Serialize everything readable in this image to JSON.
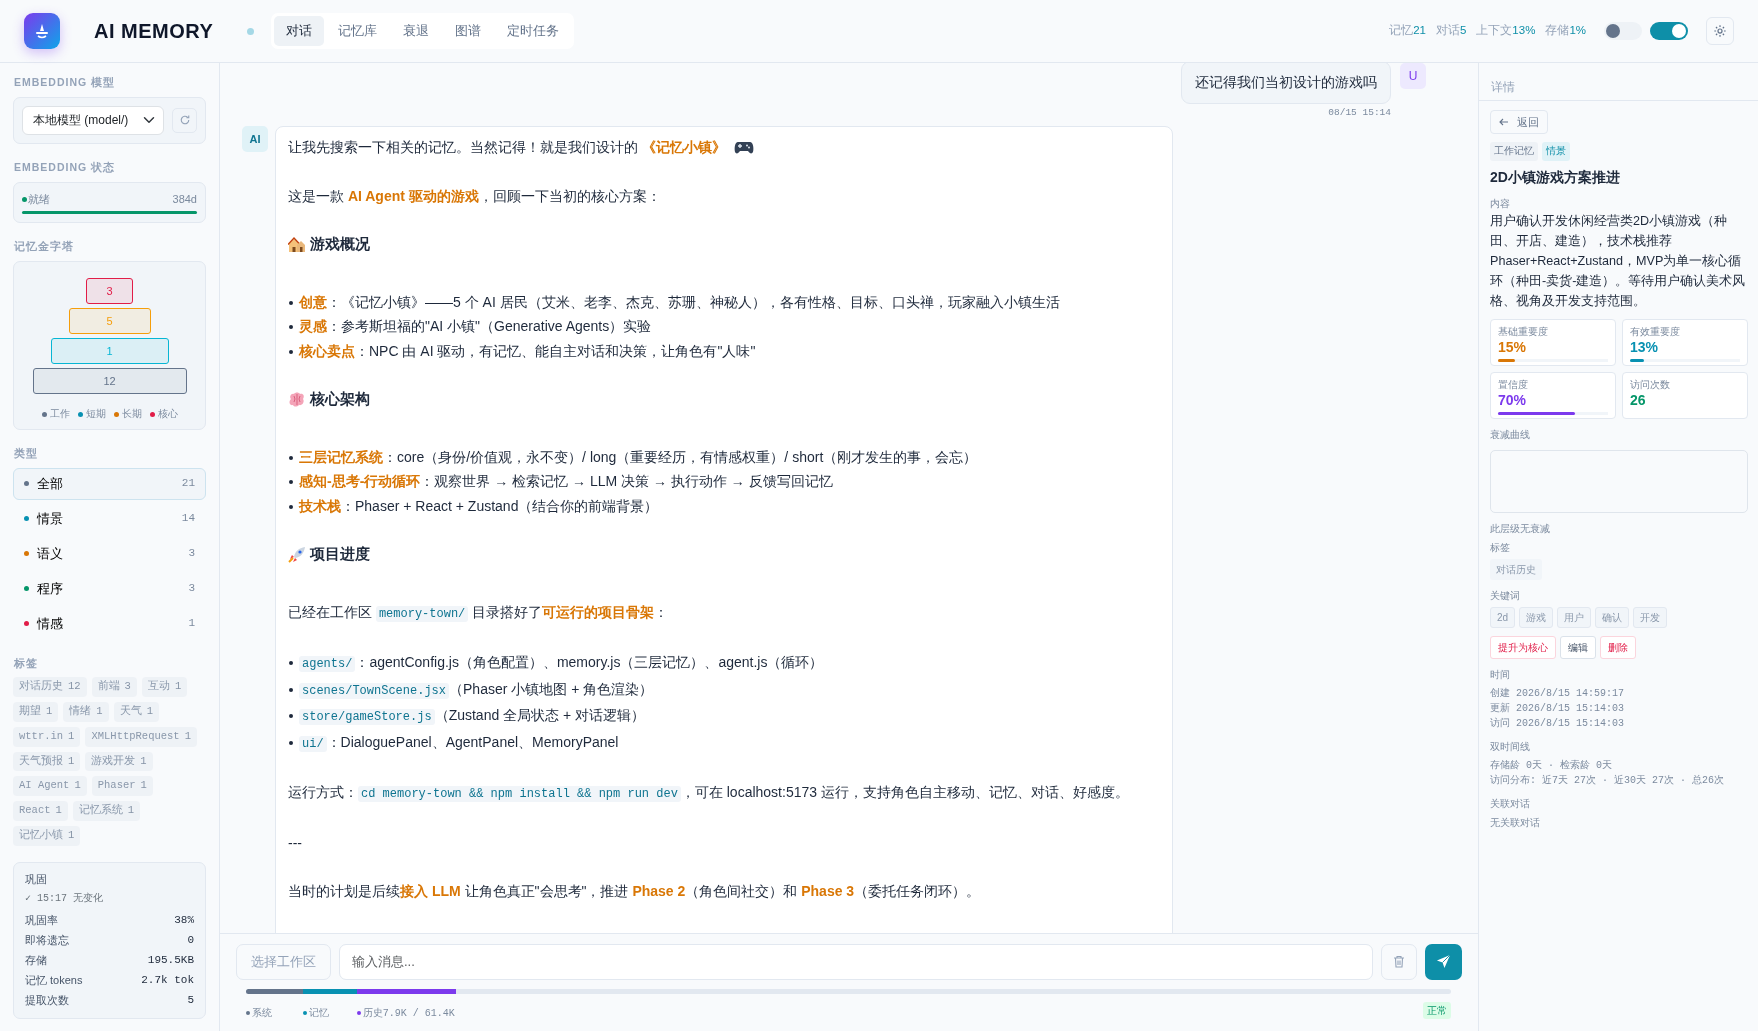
{
  "app": {
    "title": "AI MEMORY"
  },
  "nav_tabs": [
    {
      "label": "对话",
      "selected": true
    },
    {
      "label": "记忆库",
      "selected": false
    },
    {
      "label": "衰退",
      "selected": false
    },
    {
      "label": "图谱",
      "selected": false
    },
    {
      "label": "定时任务",
      "selected": false
    }
  ],
  "stats": [
    {
      "label": "记忆",
      "value": "21"
    },
    {
      "label": "对话",
      "value": "5"
    },
    {
      "label": "上下文",
      "value": "13%"
    },
    {
      "label": "存储",
      "value": "1%"
    }
  ],
  "toggles": [
    {
      "on": false
    },
    {
      "on": true
    }
  ],
  "sidebar": {
    "embedding_model": {
      "label": "EMBEDDING 模型",
      "value": "本地模型 (model/)"
    },
    "embedding_status": {
      "label": "EMBEDDING 状态",
      "status": "就绪",
      "dimension": "384d",
      "level": 1
    },
    "pyramid": {
      "label": "记忆金字塔",
      "levels": [
        {
          "count": "3",
          "color": "#e11d48"
        },
        {
          "count": "5",
          "color": "#f59e0b"
        },
        {
          "count": "1",
          "color": "#06b6d4"
        },
        {
          "count": "12",
          "color": "#64748b"
        }
      ],
      "legend": [
        {
          "label": "工作",
          "color": "#64748b"
        },
        {
          "label": "短期",
          "color": "#0891b2"
        },
        {
          "label": "长期",
          "color": "#d97706"
        },
        {
          "label": "核心",
          "color": "#e11d48"
        }
      ]
    },
    "types": {
      "label": "类型",
      "items": [
        {
          "label": "全部",
          "count": "21",
          "color": "#64748b",
          "selected": true
        },
        {
          "label": "情景",
          "count": "14",
          "color": "#0891b2",
          "selected": false
        },
        {
          "label": "语义",
          "count": "3",
          "color": "#d97706",
          "selected": false
        },
        {
          "label": "程序",
          "count": "3",
          "color": "#059669",
          "selected": false
        },
        {
          "label": "情感",
          "count": "1",
          "color": "#e11d48",
          "selected": false
        }
      ]
    },
    "tags": {
      "label": "标签",
      "items": [
        {
          "label": "对话历史",
          "count": "12"
        },
        {
          "label": "前端",
          "count": "3"
        },
        {
          "label": "互动",
          "count": "1"
        },
        {
          "label": "期望",
          "count": "1"
        },
        {
          "label": "情绪",
          "count": "1"
        },
        {
          "label": "天气",
          "count": "1"
        },
        {
          "label": "wttr.in",
          "count": "1"
        },
        {
          "label": "XMLHttpRequest",
          "count": "1"
        },
        {
          "label": "天气预报",
          "count": "1"
        },
        {
          "label": "游戏开发",
          "count": "1"
        },
        {
          "label": "AI Agent",
          "count": "1"
        },
        {
          "label": "Phaser",
          "count": "1"
        },
        {
          "label": "React",
          "count": "1"
        },
        {
          "label": "记忆系统",
          "count": "1"
        },
        {
          "label": "记忆小镇",
          "count": "1"
        }
      ]
    },
    "consolidation": {
      "title": "巩固",
      "status": "✓ 15:17 无变化",
      "rows": [
        {
          "label": "巩固率",
          "value": "38%"
        },
        {
          "label": "即将遗忘",
          "value": "0"
        },
        {
          "label": "存储",
          "value": "195.5KB"
        },
        {
          "label": "记忆 tokens",
          "value": "2.7k tok"
        },
        {
          "label": "提取次数",
          "value": "5"
        }
      ]
    }
  },
  "chat": {
    "user_message": {
      "avatar": "U",
      "text": "还记得我们当初设计的游戏吗",
      "time": "08/15 15:14"
    },
    "ai_message": {
      "avatar": "AI",
      "blocks": [
        {
          "kind": "p",
          "segments": [
            {
              "text": "让我先搜索一下相关的记忆。当然记得！就是我们设计的 ",
              "kind": "plain"
            },
            {
              "text": "《记忆小镇》",
              "kind": "accent"
            }
          ]
        },
        {
          "kind": "p",
          "segments": [
            {
              "text": "这是一款 ",
              "kind": "plain"
            },
            {
              "text": "AI Agent 驱动的游戏",
              "kind": "accent"
            },
            {
              "text": "，回顾一下当初的核心方案：",
              "kind": "plain"
            }
          ]
        },
        {
          "kind": "h",
          "segments": [
            {
              "text": "游戏概况",
              "kind": "plain"
            }
          ]
        },
        {
          "kind": "li",
          "segments": [
            {
              "text": "创意",
              "kind": "accent"
            },
            {
              "text": "：《记忆小镇》——5 个 AI 居民（艾米、老李、杰克、苏珊、神秘人），各有性格、目标、口头禅，玩家融入小镇生活",
              "kind": "plain"
            }
          ]
        },
        {
          "kind": "li",
          "segments": [
            {
              "text": "灵感",
              "kind": "accent"
            },
            {
              "text": "：参考斯坦福的\"AI 小镇\"（Generative Agents）实验",
              "kind": "plain"
            }
          ]
        },
        {
          "kind": "li",
          "segments": [
            {
              "text": "核心卖点",
              "kind": "accent"
            },
            {
              "text": "：NPC 由 AI 驱动，有记忆、能自主对话和决策，让角色有\"人味\"",
              "kind": "plain"
            }
          ]
        },
        {
          "kind": "h",
          "segments": [
            {
              "text": "核心架构",
              "kind": "plain"
            }
          ]
        },
        {
          "kind": "li",
          "segments": [
            {
              "text": "三层记忆系统",
              "kind": "accent"
            },
            {
              "text": "：core（身份/价值观，永不变）/ long（重要经历，有情感权重）/ short（刚才发生的事，会忘）",
              "kind": "plain"
            }
          ]
        },
        {
          "kind": "li",
          "segments": [
            {
              "text": "感知-思考-行动循环",
              "kind": "accent"
            },
            {
              "text": "：观察世界 → 检索记忆 → LLM 决策 → 执行动作 → 反馈写回记忆",
              "kind": "plain"
            }
          ]
        },
        {
          "kind": "li",
          "segments": [
            {
              "text": "技术栈",
              "kind": "accent"
            },
            {
              "text": "：Phaser + React + Zustand（结合你的前端背景）",
              "kind": "plain"
            }
          ]
        },
        {
          "kind": "h",
          "segments": [
            {
              "text": "项目进度",
              "kind": "plain"
            }
          ]
        },
        {
          "kind": "p",
          "segments": [
            {
              "text": "已经在工作区 ",
              "kind": "plain"
            },
            {
              "text": "memory-town/",
              "kind": "code"
            },
            {
              "text": " 目录搭好了",
              "kind": "plain"
            },
            {
              "text": "可运行的项目骨架",
              "kind": "accent"
            },
            {
              "text": "：",
              "kind": "plain"
            }
          ]
        },
        {
          "kind": "li",
          "segments": [
            {
              "text": "agents/",
              "kind": "code"
            },
            {
              "text": "：agentConfig.js（角色配置）、memory.js（三层记忆）、agent.js（循环）",
              "kind": "plain"
            }
          ]
        },
        {
          "kind": "li",
          "segments": [
            {
              "text": "scenes/TownScene.jsx",
              "kind": "code"
            },
            {
              "text": "（Phaser 小镇地图 + 角色渲染）",
              "kind": "plain"
            }
          ]
        },
        {
          "kind": "li",
          "segments": [
            {
              "text": "store/gameStore.js",
              "kind": "code"
            },
            {
              "text": "（Zustand 全局状态 + 对话逻辑）",
              "kind": "plain"
            }
          ]
        },
        {
          "kind": "li",
          "segments": [
            {
              "text": "ui/",
              "kind": "code"
            },
            {
              "text": "：DialoguePanel、AgentPanel、MemoryPanel",
              "kind": "plain"
            }
          ]
        },
        {
          "kind": "p",
          "segments": [
            {
              "text": "运行方式：",
              "kind": "plain"
            },
            {
              "text": "cd memory-town && npm install && npm run dev",
              "kind": "code"
            },
            {
              "text": "，可在 localhost:5173 运行，支持角色自主移动、记忆、对话、好感度。",
              "kind": "plain"
            }
          ]
        },
        {
          "kind": "p",
          "segments": [
            {
              "text": "---",
              "kind": "plain"
            }
          ]
        },
        {
          "kind": "p",
          "segments": [
            {
              "text": "当时的计划是后续",
              "kind": "plain"
            },
            {
              "text": "接入 LLM",
              "kind": "accent"
            },
            {
              "text": " 让角色真正\"会思考\"，推进 ",
              "kind": "plain"
            },
            {
              "text": "Phase 2",
              "kind": "accent"
            },
            {
              "text": "（角色间社交）和 ",
              "kind": "plain"
            },
            {
              "text": "Phase 3",
              "kind": "accent"
            },
            {
              "text": "（委托任务闭环）。",
              "kind": "plain"
            }
          ]
        }
      ]
    }
  },
  "composer": {
    "workspace_button": "选择工作区",
    "placeholder": "输入消息...",
    "context_segments": [
      {
        "label": "系统",
        "level": 0.047,
        "color": "#64748b"
      },
      {
        "label": "记忆",
        "level": 0.045,
        "color": "#0891b2"
      },
      {
        "label": "历史7.9K / 61.4K",
        "level": 0.082,
        "color": "#7c3aed"
      }
    ],
    "status": "正常"
  },
  "detail": {
    "header": "详情",
    "back": "返回",
    "badges": [
      {
        "label": "工作记忆",
        "kind": "tier"
      },
      {
        "label": "情景",
        "kind": "type"
      }
    ],
    "title": "2D小镇游戏方案推进",
    "content_label": "内容",
    "content": "用户确认开发休闲经营类2D小镇游戏（种田、开店、建造），技术栈推荐Phaser+React+Zustand，MVP为单一核心循环（种田-卖货-建造）。等待用户确认美术风格、视角及开发支持范围。",
    "metrics": [
      {
        "label": "基础重要度",
        "value": "15%",
        "level": 0.15,
        "color": "#d97706"
      },
      {
        "label": "有效重要度",
        "value": "13%",
        "level": 0.13,
        "color": "#0891b2"
      },
      {
        "label": "置信度",
        "value": "70%",
        "level": 0.7,
        "color": "#7c3aed"
      },
      {
        "label": "访问次数",
        "value": "26",
        "color": "#059669"
      }
    ],
    "decay_label": "衰减曲线",
    "decay_note": "此层级无衰减",
    "tags_label": "标签",
    "tags": [
      "对话历史"
    ],
    "keywords_label": "关键词",
    "keywords": [
      "2d",
      "游戏",
      "用户",
      "确认",
      "开发"
    ],
    "actions": [
      {
        "label": "提升为核心",
        "kind": "danger"
      },
      {
        "label": "编辑",
        "kind": "default"
      },
      {
        "label": "删除",
        "kind": "danger"
      }
    ],
    "time_label": "时间",
    "times": [
      "创建 2026/8/15 14:59:17",
      "更新 2026/8/15 15:14:03",
      "访问 2026/8/15 15:14:03"
    ],
    "timeline_label": "双时间线",
    "timeline": [
      "存储龄 0天 · 检索龄 0天",
      "访问分布: 近7天 27次 · 近30天 27次 · 总26次"
    ],
    "related_label": "关联对话",
    "related": "无关联对话"
  }
}
